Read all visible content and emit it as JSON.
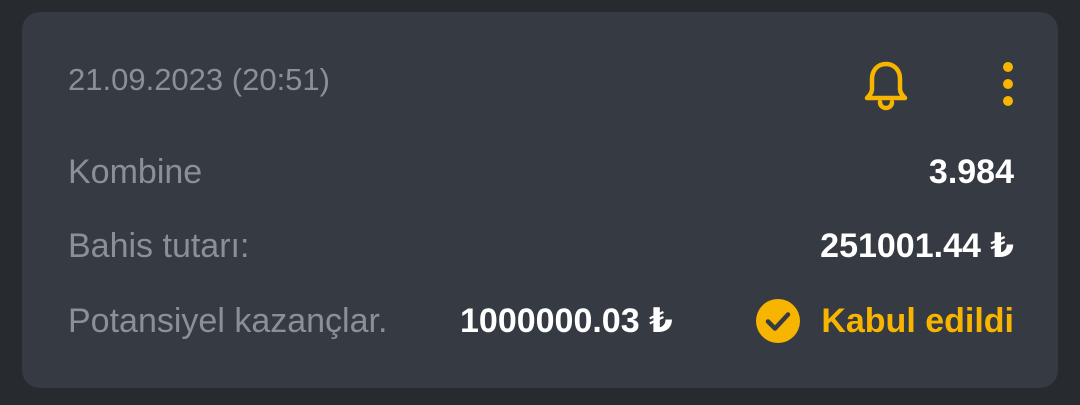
{
  "bet": {
    "datetime": "21.09.2023 (20:51)",
    "rows": [
      {
        "label": "Kombine",
        "value": "3.984"
      },
      {
        "label": "Bahis tutarı:",
        "value": "251001.44 ₺"
      },
      {
        "label": "Potansiyel kazançlar.",
        "value": "1000000.03 ₺"
      }
    ],
    "status": {
      "label": "Kabul edildi",
      "icon": "check-circle-icon"
    }
  },
  "icons": {
    "bell": "bell-icon",
    "more": "more-vertical-icon"
  },
  "colors": {
    "background": "#272a2f",
    "card": "#363a42",
    "muted_text": "#8b9098",
    "value_text": "#ffffff",
    "accent": "#f7b500"
  }
}
